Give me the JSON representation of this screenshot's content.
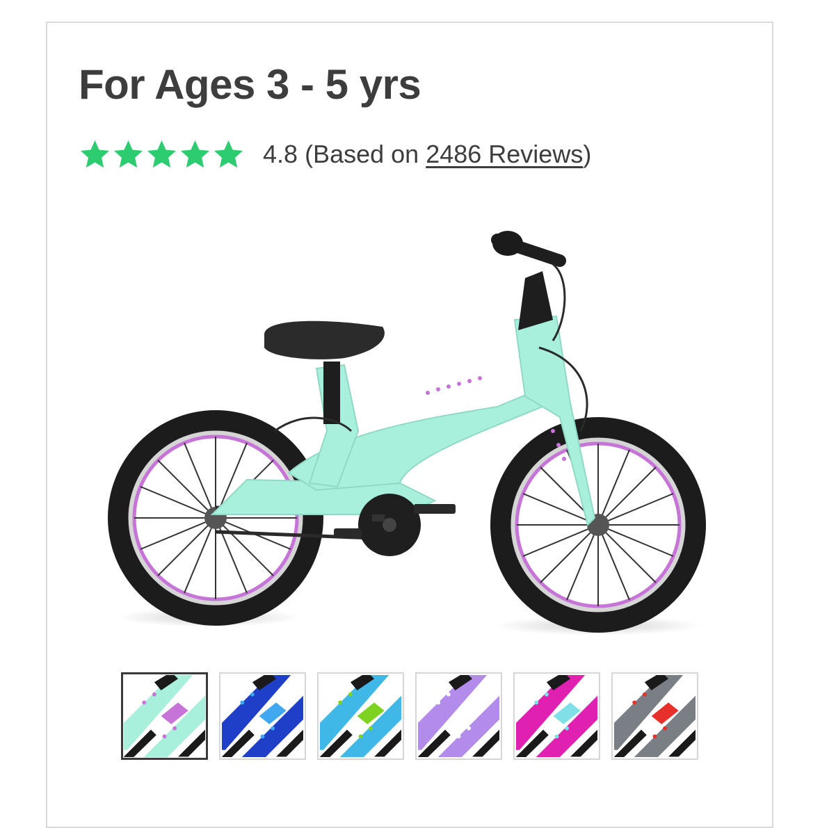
{
  "product": {
    "title": "For Ages 3 - 5 yrs",
    "rating_value": "4.8",
    "rating_prefix": "(Based on ",
    "reviews_link": "2486 Reviews",
    "rating_suffix": ")",
    "stars_filled": 5,
    "stars_total": 5,
    "star_color": "#2ecc71"
  },
  "image": {
    "frame_color": "#a8efdc",
    "rim_color": "#c774d8",
    "icon": "bike-image"
  },
  "colors": {
    "selected_index": 0,
    "swatches": [
      {
        "name": "mint",
        "primary": "#a8efdc",
        "accent": "#c774d8"
      },
      {
        "name": "blue",
        "primary": "#1f3fc8",
        "accent": "#3fa8f0"
      },
      {
        "name": "green",
        "primary": "#3fb8e8",
        "accent": "#7ed321"
      },
      {
        "name": "purple",
        "primary": "#b38bea",
        "accent": "#ffffff"
      },
      {
        "name": "pink",
        "primary": "#e020b0",
        "accent": "#7fe0e8"
      },
      {
        "name": "grey",
        "primary": "#7a7f85",
        "accent": "#e8302a"
      }
    ]
  }
}
